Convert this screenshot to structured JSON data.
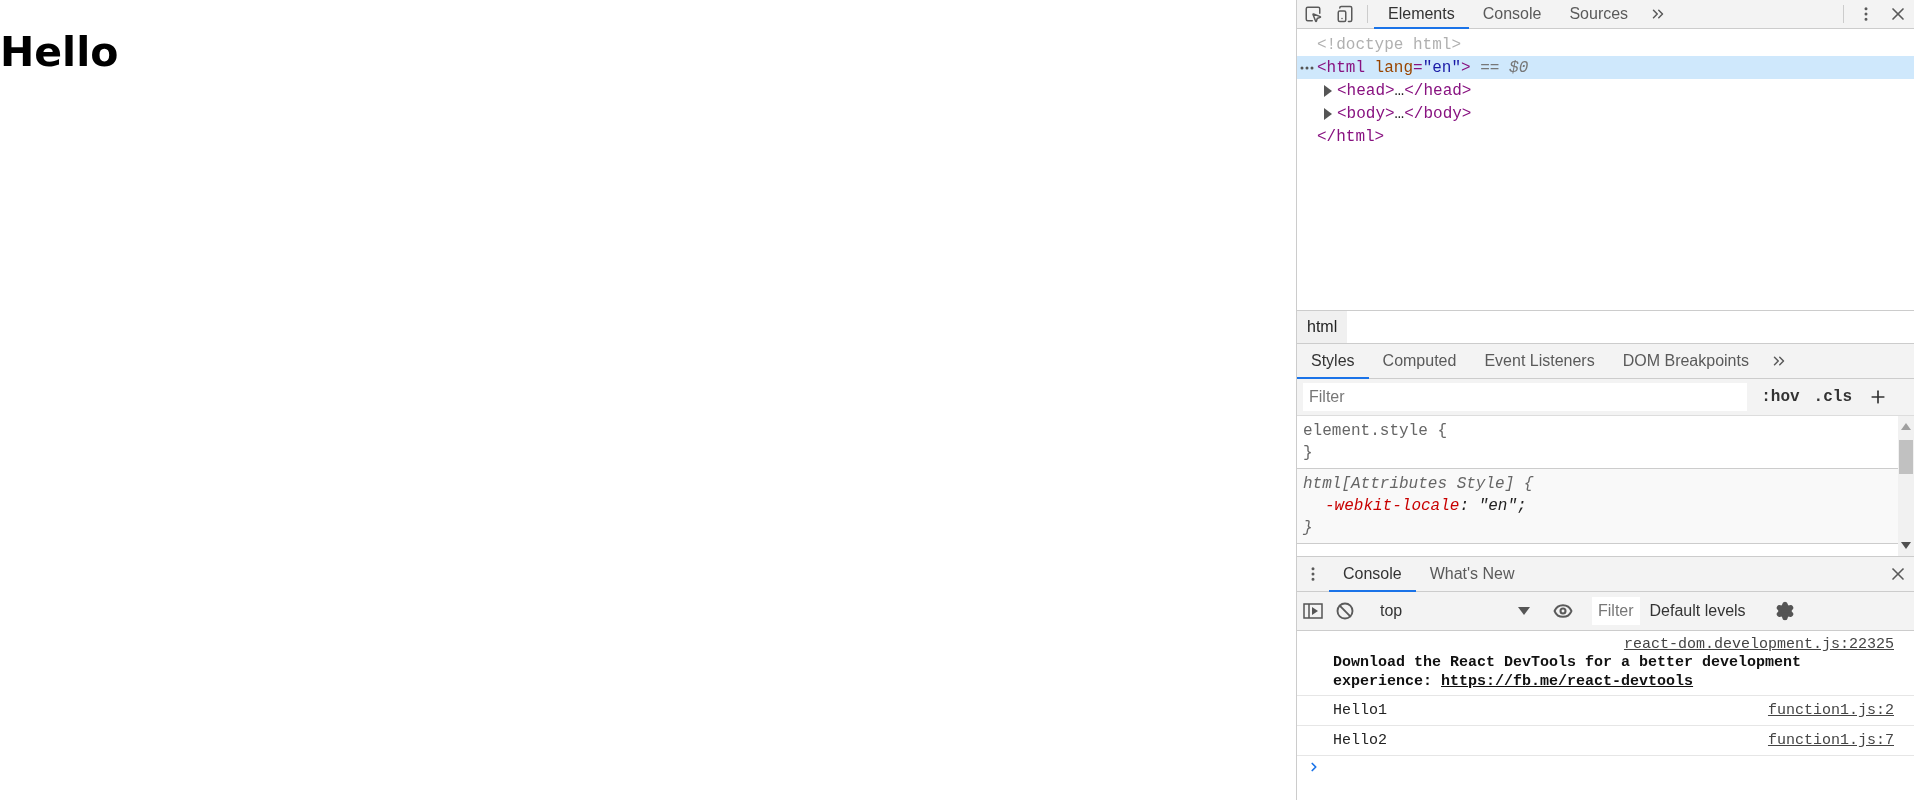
{
  "page": {
    "heading": "Hello"
  },
  "devtools": {
    "main_tabs": [
      {
        "label": "Elements",
        "selected": true
      },
      {
        "label": "Console",
        "selected": false
      },
      {
        "label": "Sources",
        "selected": false
      }
    ],
    "dom_tree": [
      {
        "segments": [
          {
            "kind": "doctype",
            "text": "<!doctype html>"
          }
        ],
        "selected": false
      },
      {
        "segments": [
          {
            "kind": "tag",
            "text": "<html"
          },
          {
            "kind": "attr-name",
            "text": " lang"
          },
          {
            "kind": "punct",
            "text": "="
          },
          {
            "kind": "attr-value",
            "text": "\"en\""
          },
          {
            "kind": "tag",
            "text": ">"
          },
          {
            "kind": "marker",
            "text": " == $0"
          }
        ],
        "selected": true,
        "children": [
          {
            "segments": [
              {
                "kind": "tag",
                "text": "<head>"
              },
              {
                "kind": "ellipsis",
                "text": "…"
              },
              {
                "kind": "tag",
                "text": "</head>"
              }
            ],
            "selected": false,
            "expanded": false
          },
          {
            "segments": [
              {
                "kind": "tag",
                "text": "<body>"
              },
              {
                "kind": "ellipsis",
                "text": "…"
              },
              {
                "kind": "tag",
                "text": "</body>"
              }
            ],
            "selected": false,
            "expanded": false
          }
        ],
        "closing": [
          {
            "kind": "tag",
            "text": "</html>"
          }
        ]
      }
    ],
    "breadcrumbs": [
      {
        "label": "html",
        "selected": true
      }
    ],
    "style_tabs": [
      {
        "label": "Styles",
        "selected": true
      },
      {
        "label": "Computed",
        "selected": false
      },
      {
        "label": "Event Listeners",
        "selected": false
      },
      {
        "label": "DOM Breakpoints",
        "selected": false
      }
    ],
    "styles_filter": {
      "placeholder": "Filter"
    },
    "style_buttons": [
      ":hov",
      ".cls"
    ],
    "rules": [
      {
        "selector": "element.style {",
        "close": "}",
        "italic": false
      },
      {
        "selector": "html[Attributes Style] {",
        "close": "}",
        "italic": true,
        "declarations": [
          {
            "property": "-webkit-locale",
            "value": ": \"en\";"
          }
        ]
      }
    ],
    "drawer_tabs": [
      {
        "label": "Console",
        "selected": true
      },
      {
        "label": "What's New",
        "selected": false
      }
    ],
    "console_toolbar": {
      "context": "top",
      "filter_placeholder": "Filter",
      "levels": "Default levels"
    },
    "messages": [
      {
        "kind": "banner",
        "source": "react-dom.development.js:22325",
        "text": "Download the React DevTools for a better development experience: ",
        "link": "https://fb.me/react-devtools"
      },
      {
        "kind": "log",
        "text": "Hello1",
        "source": "function1.js:2"
      },
      {
        "kind": "log",
        "text": "Hello2",
        "source": "function1.js:7"
      }
    ]
  }
}
